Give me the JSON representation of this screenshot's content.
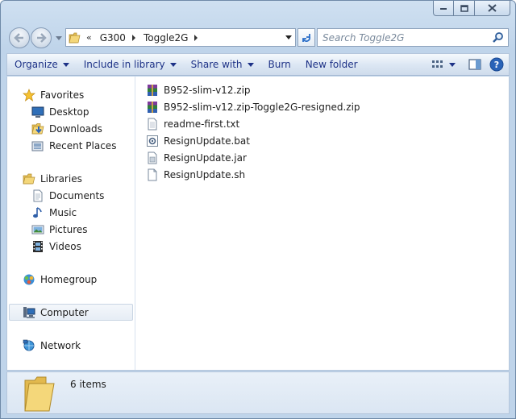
{
  "address": {
    "chevron": "«",
    "crumbs": [
      "G300",
      "Toggle2G"
    ]
  },
  "search": {
    "placeholder": "Search Toggle2G"
  },
  "toolbar": {
    "items": [
      {
        "label": "Organize",
        "dropdown": true
      },
      {
        "label": "Include in library",
        "dropdown": true
      },
      {
        "label": "Share with",
        "dropdown": true
      },
      {
        "label": "Burn",
        "dropdown": false
      },
      {
        "label": "New folder",
        "dropdown": false
      }
    ]
  },
  "nav": {
    "favorites": {
      "label": "Favorites",
      "items": [
        "Desktop",
        "Downloads",
        "Recent Places"
      ]
    },
    "libraries": {
      "label": "Libraries",
      "items": [
        "Documents",
        "Music",
        "Pictures",
        "Videos"
      ]
    },
    "homegroup": {
      "label": "Homegroup"
    },
    "computer": {
      "label": "Computer"
    },
    "network": {
      "label": "Network"
    }
  },
  "files": [
    {
      "name": "B952-slim-v12.zip",
      "icon": "winrar-archive-icon"
    },
    {
      "name": "B952-slim-v12.zip-Toggle2G-resigned.zip",
      "icon": "winrar-archive-icon"
    },
    {
      "name": "readme-first.txt",
      "icon": "text-file-icon"
    },
    {
      "name": "ResignUpdate.bat",
      "icon": "batch-file-icon"
    },
    {
      "name": "ResignUpdate.jar",
      "icon": "jar-file-icon"
    },
    {
      "name": "ResignUpdate.sh",
      "icon": "blank-file-icon"
    }
  ],
  "details": {
    "count": "6 items"
  },
  "colors": {
    "link": "#1e3287",
    "chrome": "#bfd4ea"
  }
}
